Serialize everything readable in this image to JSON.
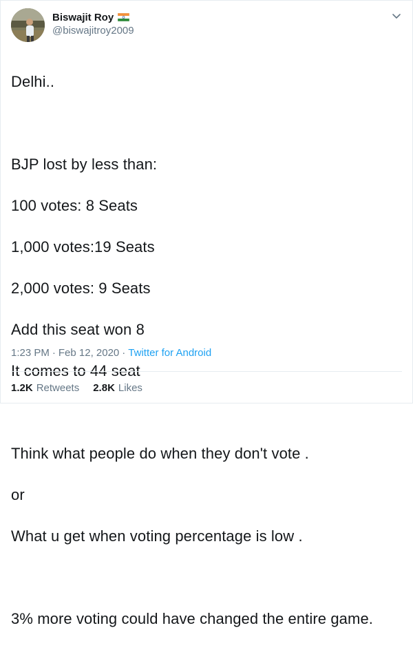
{
  "author": {
    "display_name": "Biswajit Roy",
    "handle": "@biswajitroy2009",
    "flag_icon": "india-flag-icon",
    "avatar": "profile-photo"
  },
  "tweet": {
    "lines": [
      "Delhi..",
      "",
      "BJP lost by less than:",
      "100 votes: 8 Seats",
      "1,000 votes:19 Seats",
      "2,000 votes: 9 Seats",
      "Add this seat won 8",
      "It comes to 44 seat",
      "",
      "Think what people do when they don't vote .",
      "or",
      "What u get when voting percentage is low .",
      "",
      "3% more voting could have changed the entire game."
    ]
  },
  "meta": {
    "time": "1:23 PM",
    "separator": "·",
    "date": "Feb 12, 2020",
    "separator2": "·",
    "source": "Twitter for Android"
  },
  "stats": {
    "retweets_count": "1.2K",
    "retweets_label": "Retweets",
    "likes_count": "2.8K",
    "likes_label": "Likes"
  },
  "colors": {
    "link": "#1da1f2",
    "secondary_text": "#657786",
    "primary_text": "#14171a",
    "border": "#e6ecf0"
  }
}
